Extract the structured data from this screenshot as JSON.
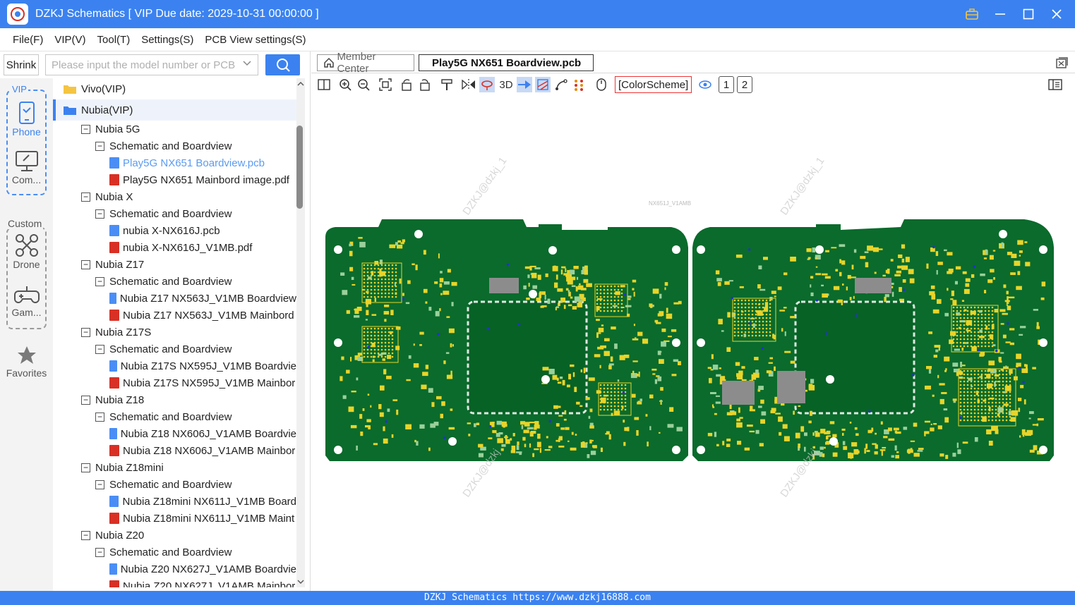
{
  "window": {
    "title": "DZKJ Schematics [ VIP Due date: 2029-10-31 00:00:00 ]"
  },
  "menu": [
    "File(F)",
    "VIP(V)",
    "Tool(T)",
    "Settings(S)",
    "PCB View settings(S)"
  ],
  "search": {
    "shrink_label": "Shrink",
    "placeholder": "Please input the model number or PCB"
  },
  "rail": {
    "vip_label": "VIP",
    "phone_label": "Phone",
    "computer_label": "Com...",
    "custom_label": "Custom",
    "drone_label": "Drone",
    "game_label": "Gam...",
    "favorites_label": "Favorites"
  },
  "tree": {
    "rows": [
      {
        "kind": "folder",
        "label": "Vivo(VIP)",
        "level": 0
      },
      {
        "kind": "folder-open",
        "label": "Nubia(VIP)",
        "level": 0,
        "selected": true
      },
      {
        "kind": "group",
        "label": "Nubia 5G",
        "level": 1
      },
      {
        "kind": "group",
        "label": "Schematic and Boardview",
        "level": 2
      },
      {
        "kind": "pcb",
        "label": "Play5G NX651 Boardview.pcb",
        "level": 3,
        "active": true
      },
      {
        "kind": "pdf",
        "label": "Play5G NX651 Mainbord image.pdf",
        "level": 3
      },
      {
        "kind": "group",
        "label": "Nubia X",
        "level": 1
      },
      {
        "kind": "group",
        "label": "Schematic and Boardview",
        "level": 2
      },
      {
        "kind": "pcb",
        "label": "nubia X-NX616J.pcb",
        "level": 3
      },
      {
        "kind": "pdf",
        "label": "nubia X-NX616J_V1MB.pdf",
        "level": 3
      },
      {
        "kind": "group",
        "label": "Nubia Z17",
        "level": 1
      },
      {
        "kind": "group",
        "label": "Schematic and Boardview",
        "level": 2
      },
      {
        "kind": "pcb",
        "label": "Nubia Z17 NX563J_V1MB Boardview",
        "level": 3
      },
      {
        "kind": "pdf",
        "label": "Nubia Z17 NX563J_V1MB Mainbord",
        "level": 3
      },
      {
        "kind": "group",
        "label": "Nubia Z17S",
        "level": 1
      },
      {
        "kind": "group",
        "label": "Schematic and Boardview",
        "level": 2
      },
      {
        "kind": "pcb",
        "label": "Nubia Z17S NX595J_V1MB Boardvie",
        "level": 3
      },
      {
        "kind": "pdf",
        "label": "Nubia Z17S NX595J_V1MB Mainbor",
        "level": 3
      },
      {
        "kind": "group",
        "label": "Nubia Z18",
        "level": 1
      },
      {
        "kind": "group",
        "label": "Schematic and Boardview",
        "level": 2
      },
      {
        "kind": "pcb",
        "label": "Nubia Z18 NX606J_V1AMB Boardvie",
        "level": 3
      },
      {
        "kind": "pdf",
        "label": "Nubia Z18 NX606J_V1AMB Mainbor",
        "level": 3
      },
      {
        "kind": "group",
        "label": "Nubia Z18mini",
        "level": 1
      },
      {
        "kind": "group",
        "label": "Schematic and Boardview",
        "level": 2
      },
      {
        "kind": "pcb",
        "label": "Nubia Z18mini NX611J_V1MB Board",
        "level": 3
      },
      {
        "kind": "pdf",
        "label": "Nubia Z18mini NX611J_V1MB Maint",
        "level": 3
      },
      {
        "kind": "group",
        "label": "Nubia Z20",
        "level": 1
      },
      {
        "kind": "group",
        "label": "Schematic and Boardview",
        "level": 2
      },
      {
        "kind": "pcb",
        "label": "Nubia Z20 NX627J_V1AMB Boardvie",
        "level": 3
      },
      {
        "kind": "pdf",
        "label": "Nubia Z20 NX627J_V1AMB Mainbor",
        "level": 3
      }
    ]
  },
  "tabs": {
    "member_center": "Member Center",
    "active_file": "Play5G NX651 Boardview.pcb"
  },
  "toolbar": {
    "label_3d": "3D",
    "color_scheme": "[ColorScheme]",
    "page1": "1",
    "page2": "2"
  },
  "board": {
    "silkscreen": "NX651J_V1AMB",
    "watermarks": [
      "DZKJ@dzkj_1",
      "DZKJ@dzkj_1",
      "DZKJ@dzkj",
      "DZKJ@dzkj"
    ],
    "colors": {
      "pcb": "#0a6b2c",
      "pad": "#e8d42a",
      "hole": "#ffffff"
    }
  },
  "statusbar": "DZKJ Schematics  https://www.dzkj16888.com",
  "colors": {
    "accent": "#3b82f0",
    "pdf": "#d93025",
    "pcb_file": "#4a8ef5"
  }
}
